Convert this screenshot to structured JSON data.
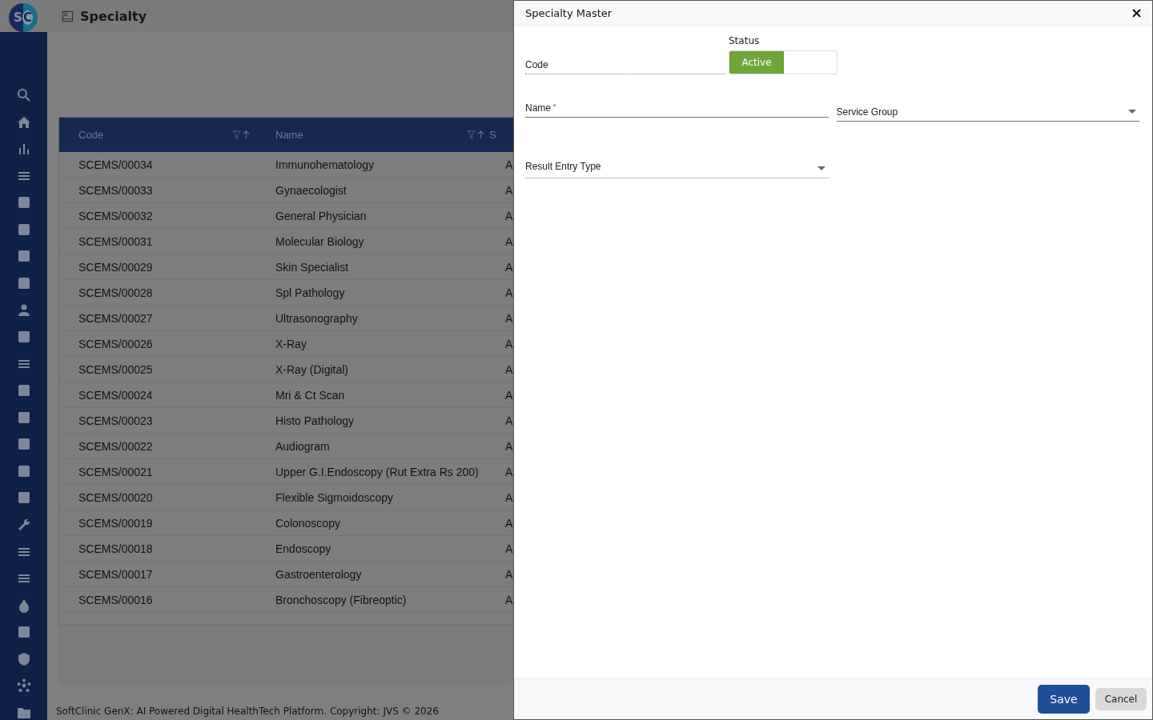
{
  "header": {
    "title": "Specialty",
    "logo": {
      "letters": [
        "S",
        "C"
      ]
    }
  },
  "table": {
    "columns": [
      {
        "label": "Code",
        "sortable": true
      },
      {
        "label": "Name",
        "sortable": true
      },
      {
        "label": "S",
        "sortable": false
      }
    ],
    "rows": [
      {
        "code": "SCEMS/00034",
        "name": "Immunohematology",
        "column_3": "A"
      },
      {
        "code": "SCEMS/00033",
        "name": "Gynaecologist",
        "column_3": "A"
      },
      {
        "code": "SCEMS/00032",
        "name": "General Physician",
        "column_3": "A"
      },
      {
        "code": "SCEMS/00031",
        "name": "Molecular Biology",
        "column_3": "A"
      },
      {
        "code": "SCEMS/00029",
        "name": "Skin Specialist",
        "column_3": "A"
      },
      {
        "code": "SCEMS/00028",
        "name": "Spl Pathology",
        "column_3": "A"
      },
      {
        "code": "SCEMS/00027",
        "name": "Ultrasonography",
        "column_3": "A"
      },
      {
        "code": "SCEMS/00026",
        "name": "X-Ray",
        "column_3": "A"
      },
      {
        "code": "SCEMS/00025",
        "name": "X-Ray (Digital)",
        "column_3": "A"
      },
      {
        "code": "SCEMS/00024",
        "name": "Mri & Ct Scan",
        "column_3": "A"
      },
      {
        "code": "SCEMS/00023",
        "name": "Histo Pathology",
        "column_3": "A"
      },
      {
        "code": "SCEMS/00022",
        "name": "Audiogram",
        "column_3": "A"
      },
      {
        "code": "SCEMS/00021",
        "name": "Upper G.I.Endoscopy (Rut Extra Rs 200)",
        "column_3": "A"
      },
      {
        "code": "SCEMS/00020",
        "name": "Flexible Sigmoidoscopy",
        "column_3": "A"
      },
      {
        "code": "SCEMS/00019",
        "name": "Colonoscopy",
        "column_3": "A"
      },
      {
        "code": "SCEMS/00018",
        "name": "Endoscopy",
        "column_3": "A"
      },
      {
        "code": "SCEMS/00017",
        "name": "Gastroenterology",
        "column_3": "A"
      },
      {
        "code": "SCEMS/00016",
        "name": "Bronchoscopy (Fibreoptic)",
        "column_3": "A"
      }
    ]
  },
  "footer": "SoftClinic GenX: AI Powered Digital HealthTech Platform. Copyright: JVS © 2026",
  "dialog": {
    "title": "Specialty Master",
    "close": "×",
    "status": {
      "label": "Status",
      "value": "Active",
      "on": true
    },
    "fields": [
      {
        "label": "Code",
        "kind": "text",
        "disabled": true,
        "required": false
      },
      {
        "label": "Name",
        "kind": "text",
        "disabled": false,
        "required": true,
        "required_mark": "*"
      },
      {
        "label": "Service Group",
        "kind": "select",
        "disabled": false,
        "required": false
      },
      {
        "label": "Result Entry Type",
        "kind": "select",
        "disabled": true,
        "required": false
      }
    ],
    "buttons": [
      {
        "label": "Save",
        "kind": "primary"
      },
      {
        "label": "Cancel",
        "kind": "secondary"
      }
    ]
  }
}
